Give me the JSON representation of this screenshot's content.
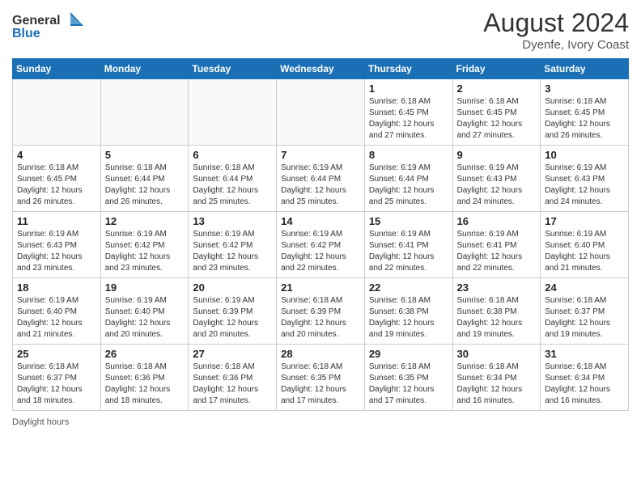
{
  "header": {
    "logo_line1": "General",
    "logo_line2": "Blue",
    "month_year": "August 2024",
    "location": "Dyenfe, Ivory Coast"
  },
  "days_of_week": [
    "Sunday",
    "Monday",
    "Tuesday",
    "Wednesday",
    "Thursday",
    "Friday",
    "Saturday"
  ],
  "weeks": [
    [
      {
        "day": "",
        "info": ""
      },
      {
        "day": "",
        "info": ""
      },
      {
        "day": "",
        "info": ""
      },
      {
        "day": "",
        "info": ""
      },
      {
        "day": "1",
        "info": "Sunrise: 6:18 AM\nSunset: 6:45 PM\nDaylight: 12 hours\nand 27 minutes."
      },
      {
        "day": "2",
        "info": "Sunrise: 6:18 AM\nSunset: 6:45 PM\nDaylight: 12 hours\nand 27 minutes."
      },
      {
        "day": "3",
        "info": "Sunrise: 6:18 AM\nSunset: 6:45 PM\nDaylight: 12 hours\nand 26 minutes."
      }
    ],
    [
      {
        "day": "4",
        "info": "Sunrise: 6:18 AM\nSunset: 6:45 PM\nDaylight: 12 hours\nand 26 minutes."
      },
      {
        "day": "5",
        "info": "Sunrise: 6:18 AM\nSunset: 6:44 PM\nDaylight: 12 hours\nand 26 minutes."
      },
      {
        "day": "6",
        "info": "Sunrise: 6:18 AM\nSunset: 6:44 PM\nDaylight: 12 hours\nand 25 minutes."
      },
      {
        "day": "7",
        "info": "Sunrise: 6:19 AM\nSunset: 6:44 PM\nDaylight: 12 hours\nand 25 minutes."
      },
      {
        "day": "8",
        "info": "Sunrise: 6:19 AM\nSunset: 6:44 PM\nDaylight: 12 hours\nand 25 minutes."
      },
      {
        "day": "9",
        "info": "Sunrise: 6:19 AM\nSunset: 6:43 PM\nDaylight: 12 hours\nand 24 minutes."
      },
      {
        "day": "10",
        "info": "Sunrise: 6:19 AM\nSunset: 6:43 PM\nDaylight: 12 hours\nand 24 minutes."
      }
    ],
    [
      {
        "day": "11",
        "info": "Sunrise: 6:19 AM\nSunset: 6:43 PM\nDaylight: 12 hours\nand 23 minutes."
      },
      {
        "day": "12",
        "info": "Sunrise: 6:19 AM\nSunset: 6:42 PM\nDaylight: 12 hours\nand 23 minutes."
      },
      {
        "day": "13",
        "info": "Sunrise: 6:19 AM\nSunset: 6:42 PM\nDaylight: 12 hours\nand 23 minutes."
      },
      {
        "day": "14",
        "info": "Sunrise: 6:19 AM\nSunset: 6:42 PM\nDaylight: 12 hours\nand 22 minutes."
      },
      {
        "day": "15",
        "info": "Sunrise: 6:19 AM\nSunset: 6:41 PM\nDaylight: 12 hours\nand 22 minutes."
      },
      {
        "day": "16",
        "info": "Sunrise: 6:19 AM\nSunset: 6:41 PM\nDaylight: 12 hours\nand 22 minutes."
      },
      {
        "day": "17",
        "info": "Sunrise: 6:19 AM\nSunset: 6:40 PM\nDaylight: 12 hours\nand 21 minutes."
      }
    ],
    [
      {
        "day": "18",
        "info": "Sunrise: 6:19 AM\nSunset: 6:40 PM\nDaylight: 12 hours\nand 21 minutes."
      },
      {
        "day": "19",
        "info": "Sunrise: 6:19 AM\nSunset: 6:40 PM\nDaylight: 12 hours\nand 20 minutes."
      },
      {
        "day": "20",
        "info": "Sunrise: 6:19 AM\nSunset: 6:39 PM\nDaylight: 12 hours\nand 20 minutes."
      },
      {
        "day": "21",
        "info": "Sunrise: 6:18 AM\nSunset: 6:39 PM\nDaylight: 12 hours\nand 20 minutes."
      },
      {
        "day": "22",
        "info": "Sunrise: 6:18 AM\nSunset: 6:38 PM\nDaylight: 12 hours\nand 19 minutes."
      },
      {
        "day": "23",
        "info": "Sunrise: 6:18 AM\nSunset: 6:38 PM\nDaylight: 12 hours\nand 19 minutes."
      },
      {
        "day": "24",
        "info": "Sunrise: 6:18 AM\nSunset: 6:37 PM\nDaylight: 12 hours\nand 19 minutes."
      }
    ],
    [
      {
        "day": "25",
        "info": "Sunrise: 6:18 AM\nSunset: 6:37 PM\nDaylight: 12 hours\nand 18 minutes."
      },
      {
        "day": "26",
        "info": "Sunrise: 6:18 AM\nSunset: 6:36 PM\nDaylight: 12 hours\nand 18 minutes."
      },
      {
        "day": "27",
        "info": "Sunrise: 6:18 AM\nSunset: 6:36 PM\nDaylight: 12 hours\nand 17 minutes."
      },
      {
        "day": "28",
        "info": "Sunrise: 6:18 AM\nSunset: 6:35 PM\nDaylight: 12 hours\nand 17 minutes."
      },
      {
        "day": "29",
        "info": "Sunrise: 6:18 AM\nSunset: 6:35 PM\nDaylight: 12 hours\nand 17 minutes."
      },
      {
        "day": "30",
        "info": "Sunrise: 6:18 AM\nSunset: 6:34 PM\nDaylight: 12 hours\nand 16 minutes."
      },
      {
        "day": "31",
        "info": "Sunrise: 6:18 AM\nSunset: 6:34 PM\nDaylight: 12 hours\nand 16 minutes."
      }
    ]
  ],
  "footer": {
    "text": "Daylight hours"
  }
}
